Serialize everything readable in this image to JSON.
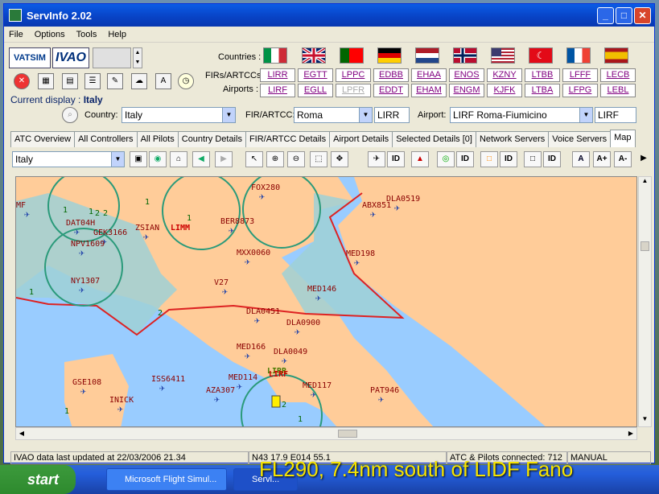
{
  "window": {
    "title": "ServInfo 2.02"
  },
  "menu": [
    "File",
    "Options",
    "Tools",
    "Help"
  ],
  "logos": {
    "vatsim": "VATSIM",
    "ivao": "IVAO"
  },
  "rows": {
    "countries_label": "Countries :",
    "firs_label": "FIRs/ARTCCs :",
    "airports_label": "Airports :"
  },
  "columns": [
    {
      "flag": "italy",
      "fir": "LIRR",
      "airport": "LIRF",
      "airport_enabled": true
    },
    {
      "flag": "uk",
      "fir": "EGTT",
      "airport": "EGLL",
      "airport_enabled": true
    },
    {
      "flag": "portugal",
      "fir": "LPPC",
      "airport": "LPFR",
      "airport_enabled": false
    },
    {
      "flag": "germany",
      "fir": "EDBB",
      "airport": "EDDT",
      "airport_enabled": true
    },
    {
      "flag": "netherlands",
      "fir": "EHAA",
      "airport": "EHAM",
      "airport_enabled": true
    },
    {
      "flag": "norway",
      "fir": "ENOS",
      "airport": "ENGM",
      "airport_enabled": true
    },
    {
      "flag": "usa",
      "fir": "KZNY",
      "airport": "KJFK",
      "airport_enabled": true
    },
    {
      "flag": "turkey",
      "fir": "LTBB",
      "airport": "LTBA",
      "airport_enabled": true
    },
    {
      "flag": "france",
      "fir": "LFFF",
      "airport": "LFPG",
      "airport_enabled": true
    },
    {
      "flag": "spain",
      "fir": "LECB",
      "airport": "LEBL",
      "airport_enabled": true
    }
  ],
  "current_display": {
    "label": "Current display :",
    "value": "Italy"
  },
  "filters": {
    "country_label": "Country:",
    "country_value": "Italy",
    "fir_label": "FIR/ARTCC:",
    "fir_value": "Roma",
    "fir_code": "LIRR",
    "airport_label": "Airport:",
    "airport_value": "LIRF Roma-Fiumicino",
    "airport_code": "LIRF"
  },
  "tabs": [
    "ATC Overview",
    "All Controllers",
    "All Pilots",
    "Country Details",
    "FIR/ARTCC Details",
    "Airport Details",
    "Selected Details [0]",
    "Network Servers",
    "Voice Servers",
    "Map"
  ],
  "active_tab": "Map",
  "map_toolbar": {
    "region_value": "Italy",
    "id_label": "ID"
  },
  "map": {
    "labels": [
      {
        "text": "FOX280",
        "kind": "plane"
      },
      {
        "text": "DLA0519",
        "kind": "plane"
      },
      {
        "text": "DAT04H",
        "kind": "plane"
      },
      {
        "text": "ZSIAN",
        "kind": "plane"
      },
      {
        "text": "LIMM",
        "kind": "airport"
      },
      {
        "text": "BER8873",
        "kind": "plane"
      },
      {
        "text": "ABX851",
        "kind": "plane"
      },
      {
        "text": "GEK3166",
        "kind": "plane"
      },
      {
        "text": "NPV1609",
        "kind": "plane"
      },
      {
        "text": "MED198",
        "kind": "plane"
      },
      {
        "text": "MXX0060",
        "kind": "plane"
      },
      {
        "text": "NY1307",
        "kind": "plane"
      },
      {
        "text": "V27",
        "kind": "plane"
      },
      {
        "text": "MED146",
        "kind": "plane"
      },
      {
        "text": "DLA0451",
        "kind": "plane"
      },
      {
        "text": "DLA0900",
        "kind": "plane"
      },
      {
        "text": "MED166",
        "kind": "plane"
      },
      {
        "text": "DLA0049",
        "kind": "plane"
      },
      {
        "text": "LIRR",
        "kind": "fir"
      },
      {
        "text": "ISS6411",
        "kind": "plane"
      },
      {
        "text": "MED114",
        "kind": "plane"
      },
      {
        "text": "MED117",
        "kind": "plane"
      },
      {
        "text": "GSE108",
        "kind": "plane"
      },
      {
        "text": "AZA307",
        "kind": "plane"
      },
      {
        "text": "PAT946",
        "kind": "plane"
      },
      {
        "text": "INICK",
        "kind": "plane"
      },
      {
        "text": "LIRF",
        "kind": "airport"
      },
      {
        "text": "MF",
        "kind": "plane"
      }
    ],
    "counts": [
      "1",
      "2",
      "1",
      "1",
      "1",
      "2",
      "2",
      "1",
      "2",
      "1",
      "1"
    ]
  },
  "status": {
    "updated": "IVAO data last updated at 22/03/2006 21.34",
    "coords": "N43 17.9  E014 55.1",
    "connected": "ATC & Pilots connected: 712",
    "mode": "MANUAL"
  },
  "taskbar": {
    "start": "start",
    "items": [
      "Microsoft Flight Simul...",
      "Servl..."
    ]
  },
  "overlay_text": "FL290, 7.4nm south of LIDF Fano",
  "colors": {
    "sea": "#99ccff",
    "land": "#ffcc99",
    "fir_fill": "#9fd0d6",
    "fir_border": "#dd2222",
    "atc_circle": "#2a9a7a",
    "label_text": "#8b0000",
    "accent": "#0a246a"
  }
}
